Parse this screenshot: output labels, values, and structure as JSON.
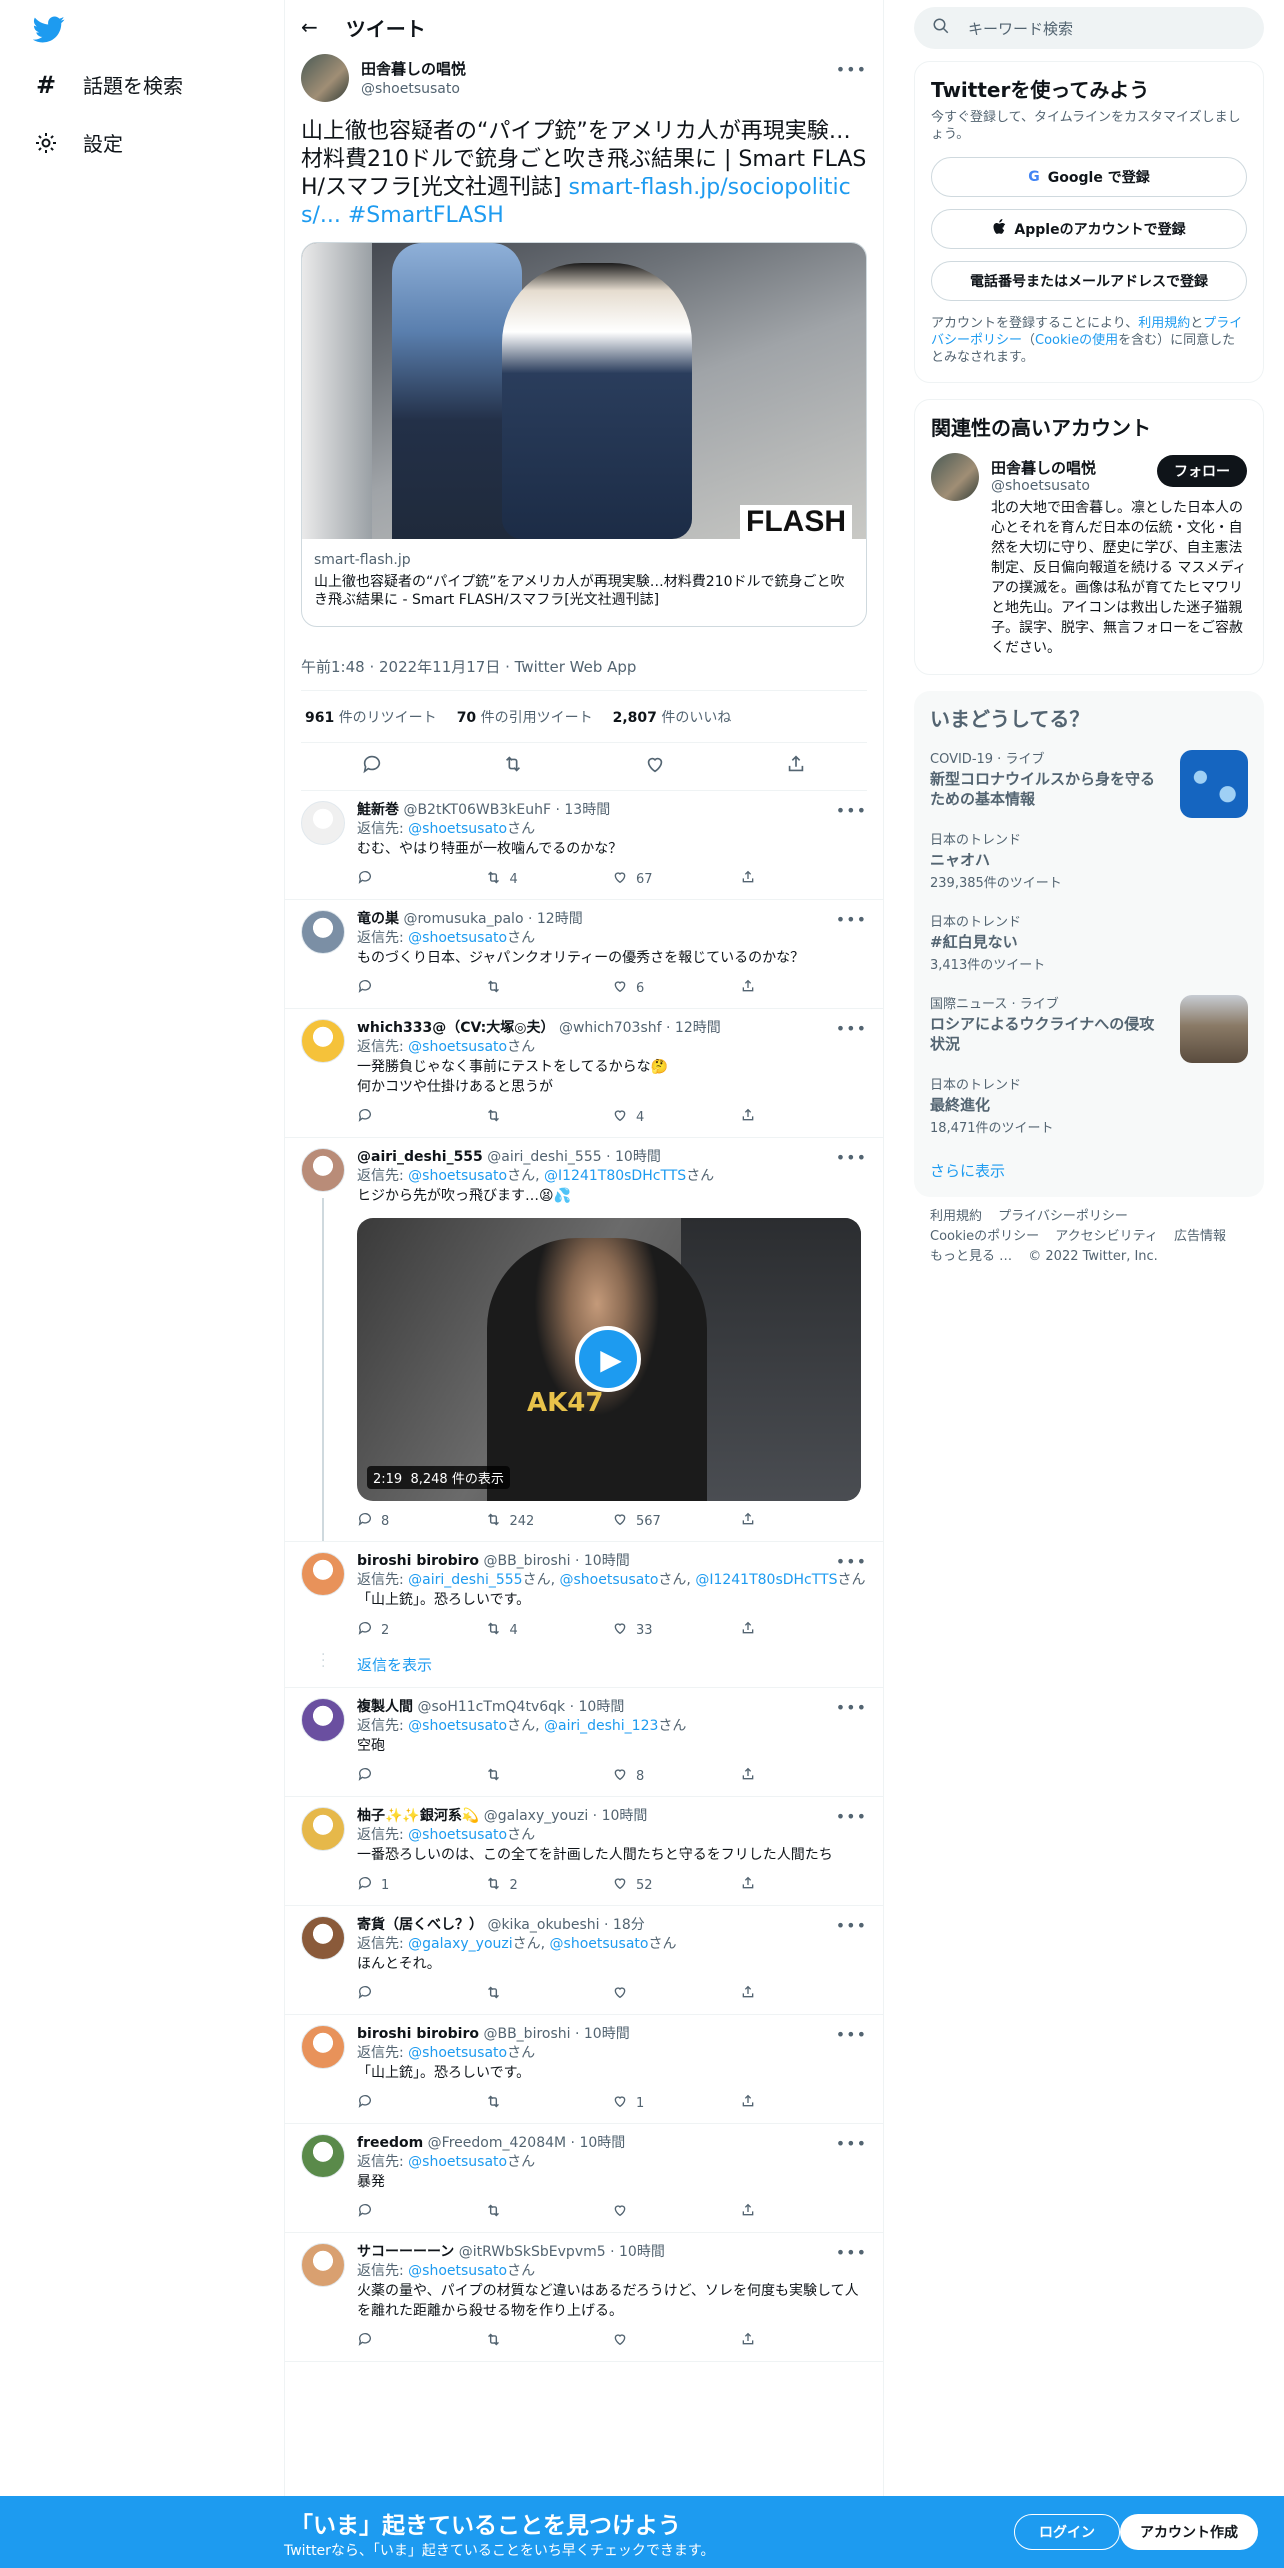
{
  "nav": {
    "explore": "話題を検索",
    "settings": "設定"
  },
  "header": {
    "back": "←",
    "title": "ツイート"
  },
  "tweet": {
    "name": "田舎暮しの唱悦",
    "handle": "@shoetsusato",
    "text": "山上徹也容疑者の“パイプ銃”をアメリカ人が再現実験…材料費210ドルで銃身ごと吹き飛ぶ結果に | Smart FLASH/スマフラ[光文社週刊誌]",
    "link": "smart-flash.jp/sociopolitics/...",
    "hashtag": "#SmartFLASH",
    "card": {
      "image_text": "FLASH",
      "domain": "smart-flash.jp",
      "description": "山上徹也容疑者の“パイプ銃”をアメリカ人が再現実験…材料費210ドルで銃身ごと吹き飛ぶ結果に - Smart FLASH/スマフラ[光文社週刊誌]"
    },
    "timestamp": "午前1:48 · 2022年11月17日 · Twitter Web App",
    "retweets": "961",
    "retweets_label": "件のリツイート",
    "quotes": "70",
    "quotes_label": "件の引用ツイート",
    "likes": "2,807",
    "likes_label": "件のいいね"
  },
  "replies": [
    {
      "name": "鮭新巻",
      "handle": "@B2tKT06WB3kEuhF",
      "time": "13時間",
      "to_prefix": "返信先:",
      "to": [
        "@shoetsusato"
      ],
      "text": "むむ、やはり特亜が一枚噛んでるのかな？",
      "reply": "",
      "rt": "4",
      "like": "67",
      "avatar": "#f0f0f0"
    },
    {
      "name": "竜の巣",
      "handle": "@romusuka_palo",
      "time": "12時間",
      "to_prefix": "返信先:",
      "to": [
        "@shoetsusato"
      ],
      "text": "ものづくり日本、ジャパンクオリティーの優秀さを報じているのかな？",
      "reply": "",
      "rt": "",
      "like": "6",
      "avatar": "#7b8fa5"
    },
    {
      "name": "which333@（CV:大塚◎夫）",
      "handle": "@which703shf",
      "time": "12時間",
      "to_prefix": "返信先:",
      "to": [
        "@shoetsusato"
      ],
      "text": "一発勝負じゃなく事前にテストをしてるからな🤔\n何かコツや仕掛けあると思うが",
      "reply": "",
      "rt": "",
      "like": "4",
      "avatar": "#f5c23a"
    },
    {
      "name": "@airi_deshi_555",
      "handle": "@airi_deshi_555",
      "time": "10時間",
      "to_prefix": "返信先:",
      "to": [
        "@shoetsusato",
        "@I1241T80sDHcTTS"
      ],
      "text": "ヒジから先が吹っ飛びます…😫💦",
      "reply": "8",
      "rt": "242",
      "like": "567",
      "avatar": "#b98c78",
      "video": {
        "duration": "2:19",
        "views": "8,248 件の表示",
        "overlay": "AK47"
      }
    },
    {
      "name": "biroshi birobiro",
      "handle": "@BB_biroshi",
      "time": "10時間",
      "to_prefix": "返信先:",
      "to": [
        "@airi_deshi_555",
        "@shoetsusato",
        "@I1241T80sDHcTTS"
      ],
      "text": "「山上銃」。恐ろしいです。",
      "reply": "2",
      "rt": "4",
      "like": "33",
      "avatar": "#e8925a"
    },
    {
      "name": "複製人間",
      "handle": "@soH11cTmQ4tv6qk",
      "time": "10時間",
      "to_prefix": "返信先:",
      "to": [
        "@shoetsusato",
        "@airi_deshi_123"
      ],
      "text": "空砲",
      "reply": "",
      "rt": "",
      "like": "8",
      "avatar": "#6a4fa0"
    },
    {
      "name": "柚子✨✨銀河系💫",
      "handle": "@galaxy_youzi",
      "time": "10時間",
      "to_prefix": "返信先:",
      "to": [
        "@shoetsusato"
      ],
      "text": "一番恐ろしいのは、この全てを計画した人間たちと守るをフリした人間たち",
      "reply": "1",
      "rt": "2",
      "like": "52",
      "avatar": "#e6b84a"
    },
    {
      "name": "寄貨（居くべし？）",
      "handle": "@kika_okubeshi",
      "time": "18分",
      "to_prefix": "返信先:",
      "to": [
        "@galaxy_youzi",
        "@shoetsusato"
      ],
      "text": "ほんとそれ。",
      "reply": "",
      "rt": "",
      "like": "",
      "avatar": "#8a5a3a"
    },
    {
      "name": "biroshi birobiro",
      "handle": "@BB_biroshi",
      "time": "10時間",
      "to_prefix": "返信先:",
      "to": [
        "@shoetsusato"
      ],
      "text": "「山上銃」。恐ろしいです。",
      "reply": "",
      "rt": "",
      "like": "1",
      "avatar": "#e8925a"
    },
    {
      "name": "freedom",
      "handle": "@Freedom_42084M",
      "time": "10時間",
      "to_prefix": "返信先:",
      "to": [
        "@shoetsusato"
      ],
      "text": "暴発",
      "reply": "",
      "rt": "",
      "like": "",
      "avatar": "#5a8a4a"
    },
    {
      "name": "サコーーーーン",
      "handle": "@itRWbSkSbEvpvm5",
      "time": "10時間",
      "to_prefix": "返信先:",
      "to": [
        "@shoetsusato"
      ],
      "text": "火薬の量や、パイプの材質など違いはあるだろうけど、ソレを何度も実験して人を離れた距離から殺せる物を作り上げる。",
      "reply": "",
      "rt": "",
      "like": "",
      "avatar": "#d9a070"
    }
  ],
  "to_suffix": "さん",
  "show_replies": "返信を表示",
  "search_placeholder": "キーワード検索",
  "signup_panel": {
    "title": "Twitterを使ってみよう",
    "sub": "今すぐ登録して、タイムラインをカスタマイズしましょう。",
    "google": "Google で登録",
    "apple": "Appleのアカウントで登録",
    "phone": "電話番号またはメールアドレスで登録",
    "fine_1": "アカウントを登録することにより、",
    "fine_terms": "利用規約",
    "fine_and": "と",
    "fine_privacy": "プライバシーポリシー",
    "fine_2": "（",
    "fine_cookie": "Cookieの使用",
    "fine_3": "を含む）に同意したとみなされます。"
  },
  "related": {
    "title": "関連性の高いアカウント",
    "name": "田舎暮しの唱悦",
    "handle": "@shoetsusato",
    "follow": "フォロー",
    "bio": "北の大地で田舎暮し。凛とした日本人の心とそれを育んだ日本の伝統・文化・自然を大切に守り、歴史に学び、自主憲法制定、反日偏向報道を続ける マスメディアの撲滅を。画像は私が育てたヒマワリと地先山。アイコンは救出した迷子猫親子。誤字、脱字、無言フォローをご容赦ください。"
  },
  "trends": {
    "title": "いまどうしてる？",
    "items": [
      {
        "ctx": "COVID-19 · ライブ",
        "t": "新型コロナウイルスから身を守るための基本情報",
        "cnt": ""
      },
      {
        "ctx": "日本のトレンド",
        "t": "ニャオハ",
        "cnt": "239,385件のツイート"
      },
      {
        "ctx": "日本のトレンド",
        "t": "#紅白見ない",
        "cnt": "3,413件のツイート"
      },
      {
        "ctx": "国際ニュース · ライブ",
        "t": "ロシアによるウクライナへの侵攻状況",
        "cnt": ""
      },
      {
        "ctx": "日本のトレンド",
        "t": "最終進化",
        "cnt": "18,471件のツイート"
      }
    ],
    "show_more": "さらに表示"
  },
  "footer": {
    "terms": "利用規約",
    "privacy": "プライバシーポリシー",
    "cookie": "Cookieのポリシー",
    "accessibility": "アクセシビリティ",
    "ads": "広告情報",
    "more": "もっと見る …",
    "copyright": "© 2022 Twitter, Inc."
  },
  "bottombar": {
    "head": "「いま」起きていることを見つけよう",
    "sub": "Twitterなら、「いま」起きていることをいち早くチェックできます。",
    "login": "ログイン",
    "signup": "アカウント作成"
  },
  "colors": {
    "accent": "#1d9bf0",
    "text": "#0f1419",
    "muted": "#536471"
  }
}
